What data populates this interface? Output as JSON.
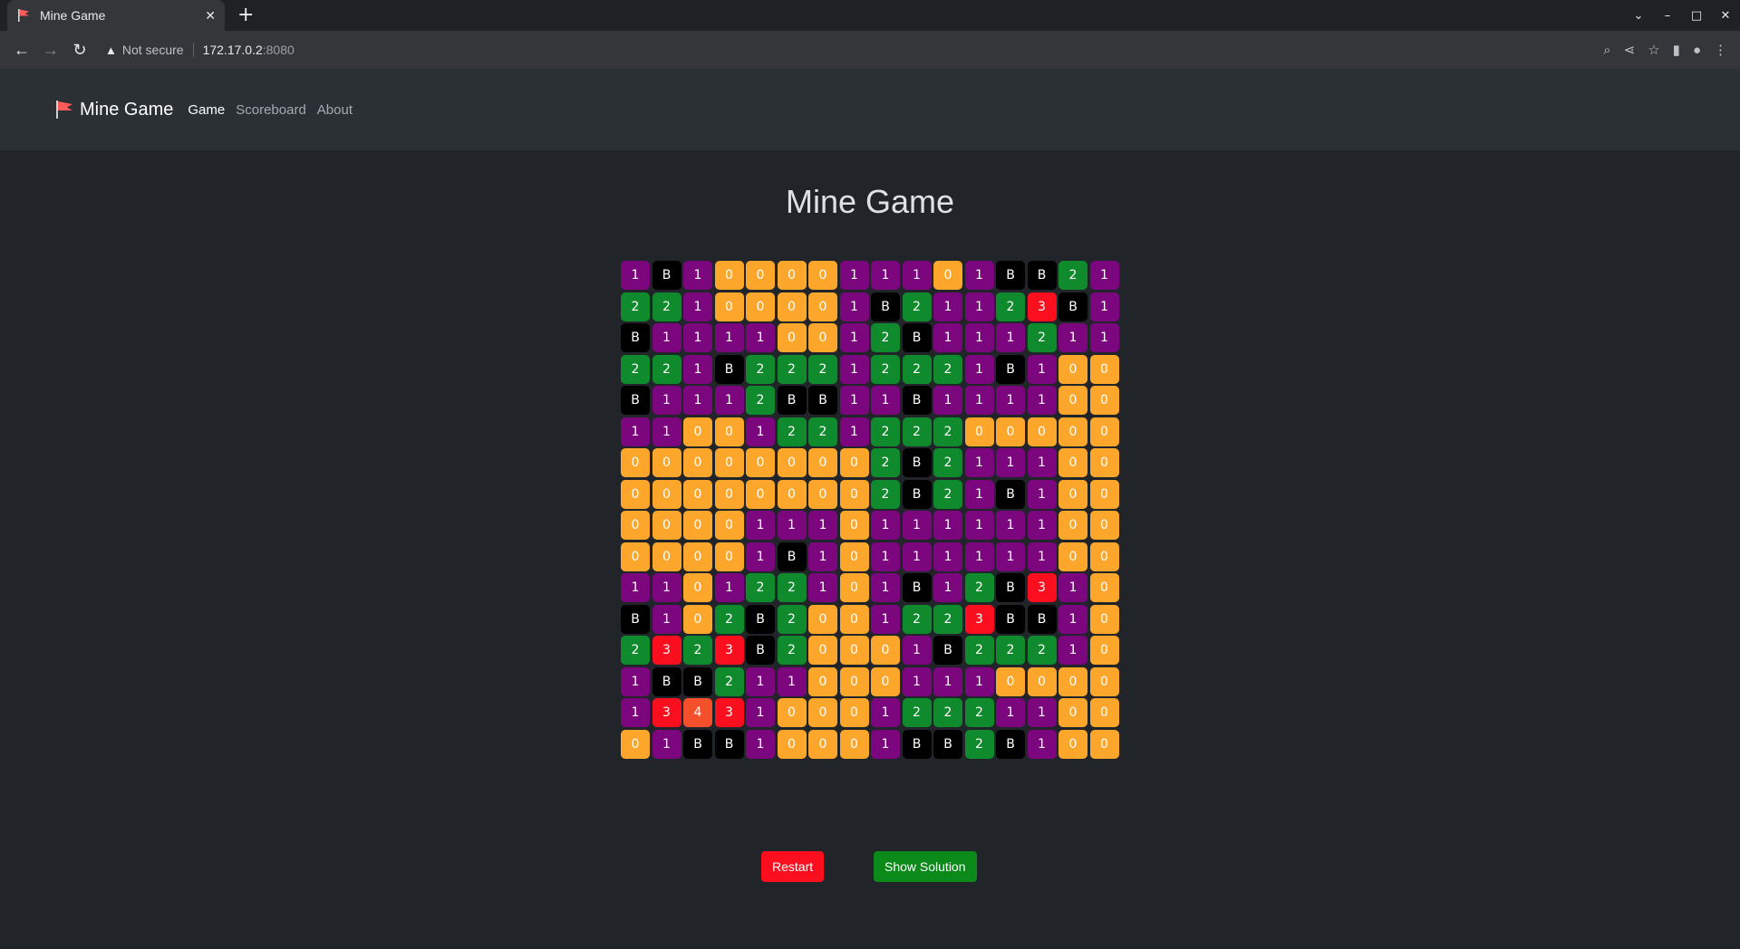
{
  "browser": {
    "tab_title": "Mine Game",
    "tab_close": "✕",
    "new_tab": "+",
    "not_secure": "Not secure",
    "url_host": "172.17.0.2",
    "url_port": ":8080"
  },
  "navbar": {
    "brand": "Mine Game",
    "links": [
      "Game",
      "Scoreboard",
      "About"
    ]
  },
  "main": {
    "title": "Mine Game",
    "restart_label": "Restart",
    "solution_label": "Show Solution"
  },
  "colors": {
    "zero": "#fca72c",
    "one": "#7c067e",
    "two": "#0f8a2c",
    "three": "#fb0f1e",
    "four": "#f4502c",
    "bomb": "#000000"
  },
  "board": [
    [
      "1",
      "B",
      "1",
      "0",
      "0",
      "0",
      "0",
      "1",
      "1",
      "1",
      "0",
      "1",
      "B",
      "B",
      "2",
      "1"
    ],
    [
      "2",
      "2",
      "1",
      "0",
      "0",
      "0",
      "0",
      "1",
      "B",
      "2",
      "1",
      "1",
      "2",
      "3",
      "B",
      "1"
    ],
    [
      "B",
      "1",
      "1",
      "1",
      "1",
      "0",
      "0",
      "1",
      "2",
      "B",
      "1",
      "1",
      "1",
      "2",
      "1",
      "1"
    ],
    [
      "2",
      "2",
      "1",
      "B",
      "2",
      "2",
      "2",
      "1",
      "2",
      "2",
      "2",
      "1",
      "B",
      "1",
      "0",
      "0"
    ],
    [
      "B",
      "1",
      "1",
      "1",
      "2",
      "B",
      "B",
      "1",
      "1",
      "B",
      "1",
      "1",
      "1",
      "1",
      "0",
      "0"
    ],
    [
      "1",
      "1",
      "0",
      "0",
      "1",
      "2",
      "2",
      "1",
      "2",
      "2",
      "2",
      "0",
      "0",
      "0",
      "0",
      "0"
    ],
    [
      "0",
      "0",
      "0",
      "0",
      "0",
      "0",
      "0",
      "0",
      "2",
      "B",
      "2",
      "1",
      "1",
      "1",
      "0",
      "0"
    ],
    [
      "0",
      "0",
      "0",
      "0",
      "0",
      "0",
      "0",
      "0",
      "2",
      "B",
      "2",
      "1",
      "B",
      "1",
      "0",
      "0"
    ],
    [
      "0",
      "0",
      "0",
      "0",
      "1",
      "1",
      "1",
      "0",
      "1",
      "1",
      "1",
      "1",
      "1",
      "1",
      "0",
      "0"
    ],
    [
      "0",
      "0",
      "0",
      "0",
      "1",
      "B",
      "1",
      "0",
      "1",
      "1",
      "1",
      "1",
      "1",
      "1",
      "0",
      "0"
    ],
    [
      "1",
      "1",
      "0",
      "1",
      "2",
      "2",
      "1",
      "0",
      "1",
      "B",
      "1",
      "2",
      "B",
      "3",
      "1",
      "0"
    ],
    [
      "B",
      "1",
      "0",
      "2",
      "B",
      "2",
      "0",
      "0",
      "1",
      "2",
      "2",
      "3",
      "B",
      "B",
      "1",
      "0"
    ],
    [
      "2",
      "3",
      "2",
      "3",
      "B",
      "2",
      "0",
      "0",
      "0",
      "1",
      "B",
      "2",
      "2",
      "2",
      "1",
      "0"
    ],
    [
      "1",
      "B",
      "B",
      "2",
      "1",
      "1",
      "0",
      "0",
      "0",
      "1",
      "1",
      "1",
      "0",
      "0",
      "0",
      "0"
    ],
    [
      "1",
      "3",
      "4",
      "3",
      "1",
      "0",
      "0",
      "0",
      "1",
      "2",
      "2",
      "2",
      "1",
      "1",
      "0",
      "0"
    ],
    [
      "0",
      "1",
      "B",
      "B",
      "1",
      "0",
      "0",
      "0",
      "1",
      "B",
      "B",
      "2",
      "B",
      "1",
      "0",
      "0"
    ]
  ]
}
